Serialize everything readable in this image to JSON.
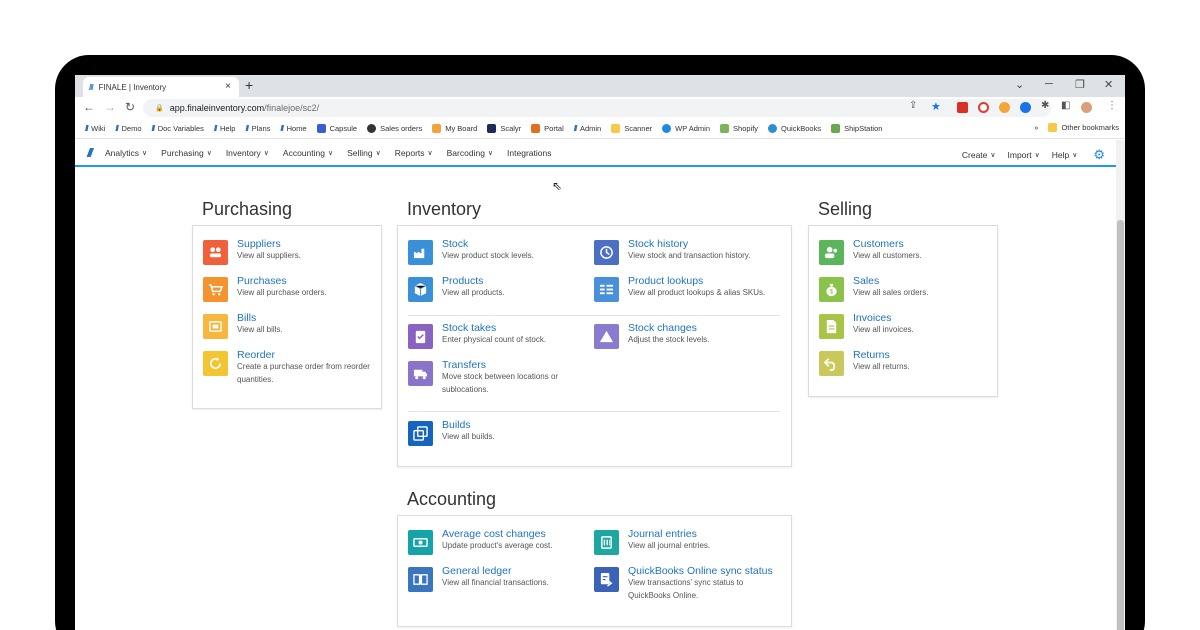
{
  "browser": {
    "tab_title": "FINALE | Inventory",
    "tab_close": "×",
    "new_tab": "+",
    "url_host": "app.finaleinventory.com",
    "url_path": "/finalejoe/sc2/",
    "bookmarks": [
      {
        "label": "Wiki",
        "icon": "finale-slash"
      },
      {
        "label": "Demo",
        "icon": "finale-slash"
      },
      {
        "label": "Doc Variables",
        "icon": "finale-slash"
      },
      {
        "label": "Help",
        "icon": "finale-slash"
      },
      {
        "label": "Plans",
        "icon": "finale-slash"
      },
      {
        "label": "Home",
        "icon": "finale-slash"
      },
      {
        "label": "Capsule",
        "icon": "capsule-icon"
      },
      {
        "label": "Sales orders",
        "icon": "github-icon"
      },
      {
        "label": "My Board",
        "icon": "board-icon"
      },
      {
        "label": "Scalyr",
        "icon": "scalyr-icon"
      },
      {
        "label": "Portal",
        "icon": "portal-icon"
      },
      {
        "label": "Admin",
        "icon": "finale-slash"
      },
      {
        "label": "Scanner",
        "icon": "folder-icon"
      },
      {
        "label": "WP Admin",
        "icon": "wp-icon"
      },
      {
        "label": "Shopify",
        "icon": "shopify-icon"
      },
      {
        "label": "QuickBooks",
        "icon": "quickbooks-icon"
      },
      {
        "label": "ShipStation",
        "icon": "shipstation-icon"
      }
    ],
    "bookmarks_overflow": "»",
    "other_bookmarks": "Other bookmarks"
  },
  "appnav": {
    "left": [
      "Analytics",
      "Purchasing",
      "Inventory",
      "Accounting",
      "Selling",
      "Reports",
      "Barcoding",
      "Integrations"
    ],
    "left_has_chevron": [
      true,
      true,
      true,
      true,
      true,
      true,
      true,
      false
    ],
    "right": [
      "Create",
      "Import",
      "Help"
    ]
  },
  "purchasing": {
    "title": "Purchasing",
    "items": [
      {
        "title": "Suppliers",
        "desc": "View all suppliers.",
        "color": "#f0603a",
        "icon": "suppliers-icon"
      },
      {
        "title": "Purchases",
        "desc": "View all purchase orders.",
        "color": "#f5932e",
        "icon": "cart-icon"
      },
      {
        "title": "Bills",
        "desc": "View all bills.",
        "color": "#f6b73c",
        "icon": "bill-icon"
      },
      {
        "title": "Reorder",
        "desc": "Create a purchase order from reorder quantities.",
        "color": "#f3c533",
        "icon": "refresh-icon"
      }
    ]
  },
  "inventory": {
    "title": "Inventory",
    "items": [
      {
        "title": "Stock",
        "desc": "View product stock levels.",
        "color": "#3a8fd9",
        "icon": "factory-icon"
      },
      {
        "title": "Stock history",
        "desc": "View stock and transaction history.",
        "color": "#4a6fc4",
        "icon": "history-icon"
      },
      {
        "title": "Products",
        "desc": "View all products.",
        "color": "#3a8fd9",
        "icon": "box-icon"
      },
      {
        "title": "Product lookups",
        "desc": "View all product lookups & alias SKUs.",
        "color": "#4a8fd9",
        "icon": "lookup-icon"
      },
      {
        "title": "Stock takes",
        "desc": "Enter physical count of stock.",
        "color": "#8a62c4",
        "icon": "clipboard-icon"
      },
      {
        "title": "Stock changes",
        "desc": "Adjust the stock levels.",
        "color": "#8a7bd0",
        "icon": "triangle-icon"
      },
      {
        "title": "Transfers",
        "desc": "Move stock between locations or sublocations.",
        "color": "#8a74c9",
        "icon": "truck-icon"
      },
      {
        "title": "Builds",
        "desc": "View all builds.",
        "color": "#1565c0",
        "icon": "builds-icon"
      }
    ]
  },
  "selling": {
    "title": "Selling",
    "items": [
      {
        "title": "Customers",
        "desc": "View all customers.",
        "color": "#5bb55a",
        "icon": "customers-icon"
      },
      {
        "title": "Sales",
        "desc": "View all sales orders.",
        "color": "#8bc34a",
        "icon": "moneybag-icon"
      },
      {
        "title": "Invoices",
        "desc": "View all invoices.",
        "color": "#a8c548",
        "icon": "invoice-icon"
      },
      {
        "title": "Returns",
        "desc": "View all returns.",
        "color": "#c8c95a",
        "icon": "return-icon"
      }
    ]
  },
  "accounting": {
    "title": "Accounting",
    "items": [
      {
        "title": "Average cost changes",
        "desc": "Update product's average cost.",
        "color": "#14a3a8",
        "icon": "cash-icon"
      },
      {
        "title": "Journal entries",
        "desc": "View all journal entries.",
        "color": "#1fa6a0",
        "icon": "journal-icon"
      },
      {
        "title": "General ledger",
        "desc": "View all financial transactions.",
        "color": "#3a76c0",
        "icon": "ledger-icon"
      },
      {
        "title": "QuickBooks Online sync status",
        "desc": "View transactions' sync status to QuickBooks Online.",
        "color": "#3a63b8",
        "icon": "sync-icon"
      }
    ]
  }
}
